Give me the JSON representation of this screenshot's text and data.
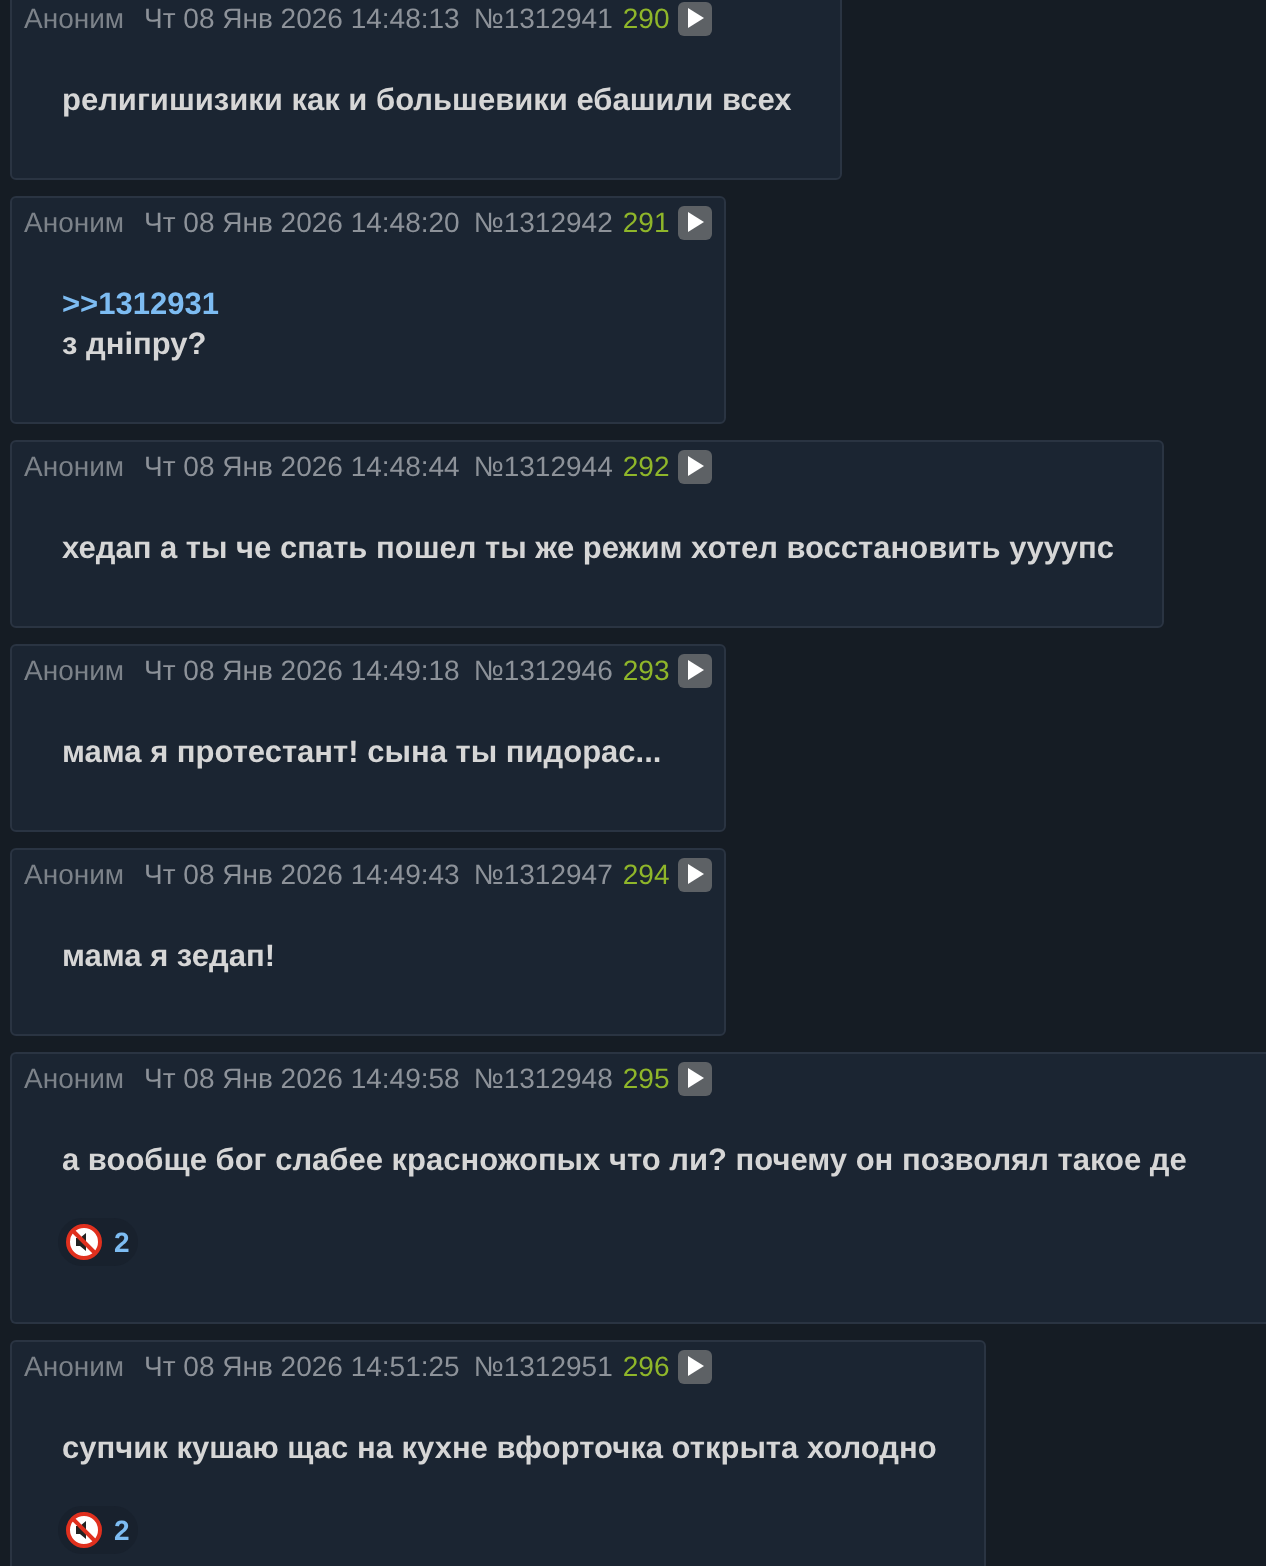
{
  "posts": [
    {
      "name": "Аноним",
      "date": "Чт 08 Янв 2026 14:48:13",
      "number": "№1312941",
      "index": "290",
      "body": [
        {
          "kind": "text",
          "text": "религишизики как и большевики ебашили всех"
        }
      ]
    },
    {
      "name": "Аноним",
      "date": "Чт 08 Янв 2026 14:48:20",
      "number": "№1312942",
      "index": "291",
      "body": [
        {
          "kind": "reply_link",
          "text": ">>1312931"
        },
        {
          "kind": "text",
          "text": "з дніпру?"
        }
      ]
    },
    {
      "name": "Аноним",
      "date": "Чт 08 Янв 2026 14:48:44",
      "number": "№1312944",
      "index": "292",
      "body": [
        {
          "kind": "text",
          "text": "хедап а ты че спать пошел ты же режим хотел восстановить уууупс"
        }
      ]
    },
    {
      "name": "Аноним",
      "date": "Чт 08 Янв 2026 14:49:18",
      "number": "№1312946",
      "index": "293",
      "body": [
        {
          "kind": "text",
          "text": "мама я протестант! сына ты пидорас..."
        }
      ]
    },
    {
      "name": "Аноним",
      "date": "Чт 08 Янв 2026 14:49:43",
      "number": "№1312947",
      "index": "294",
      "body": [
        {
          "kind": "text",
          "text": "мама я зедап!"
        }
      ]
    },
    {
      "name": "Аноним",
      "date": "Чт 08 Янв 2026 14:49:58",
      "number": "№1312948",
      "index": "295",
      "body": [
        {
          "kind": "text",
          "text": "а вообще бог слабее красножопых что ли? почему он позволял такое де"
        }
      ],
      "reactions": [
        {
          "count": "2"
        }
      ]
    },
    {
      "name": "Аноним",
      "date": "Чт 08 Янв 2026 14:51:25",
      "number": "№1312951",
      "index": "296",
      "body": [
        {
          "kind": "text",
          "text": "супчик кушаю щас на кухне вфорточка открыта холодно"
        }
      ],
      "reactions": [
        {
          "count": "2"
        }
      ]
    }
  ]
}
